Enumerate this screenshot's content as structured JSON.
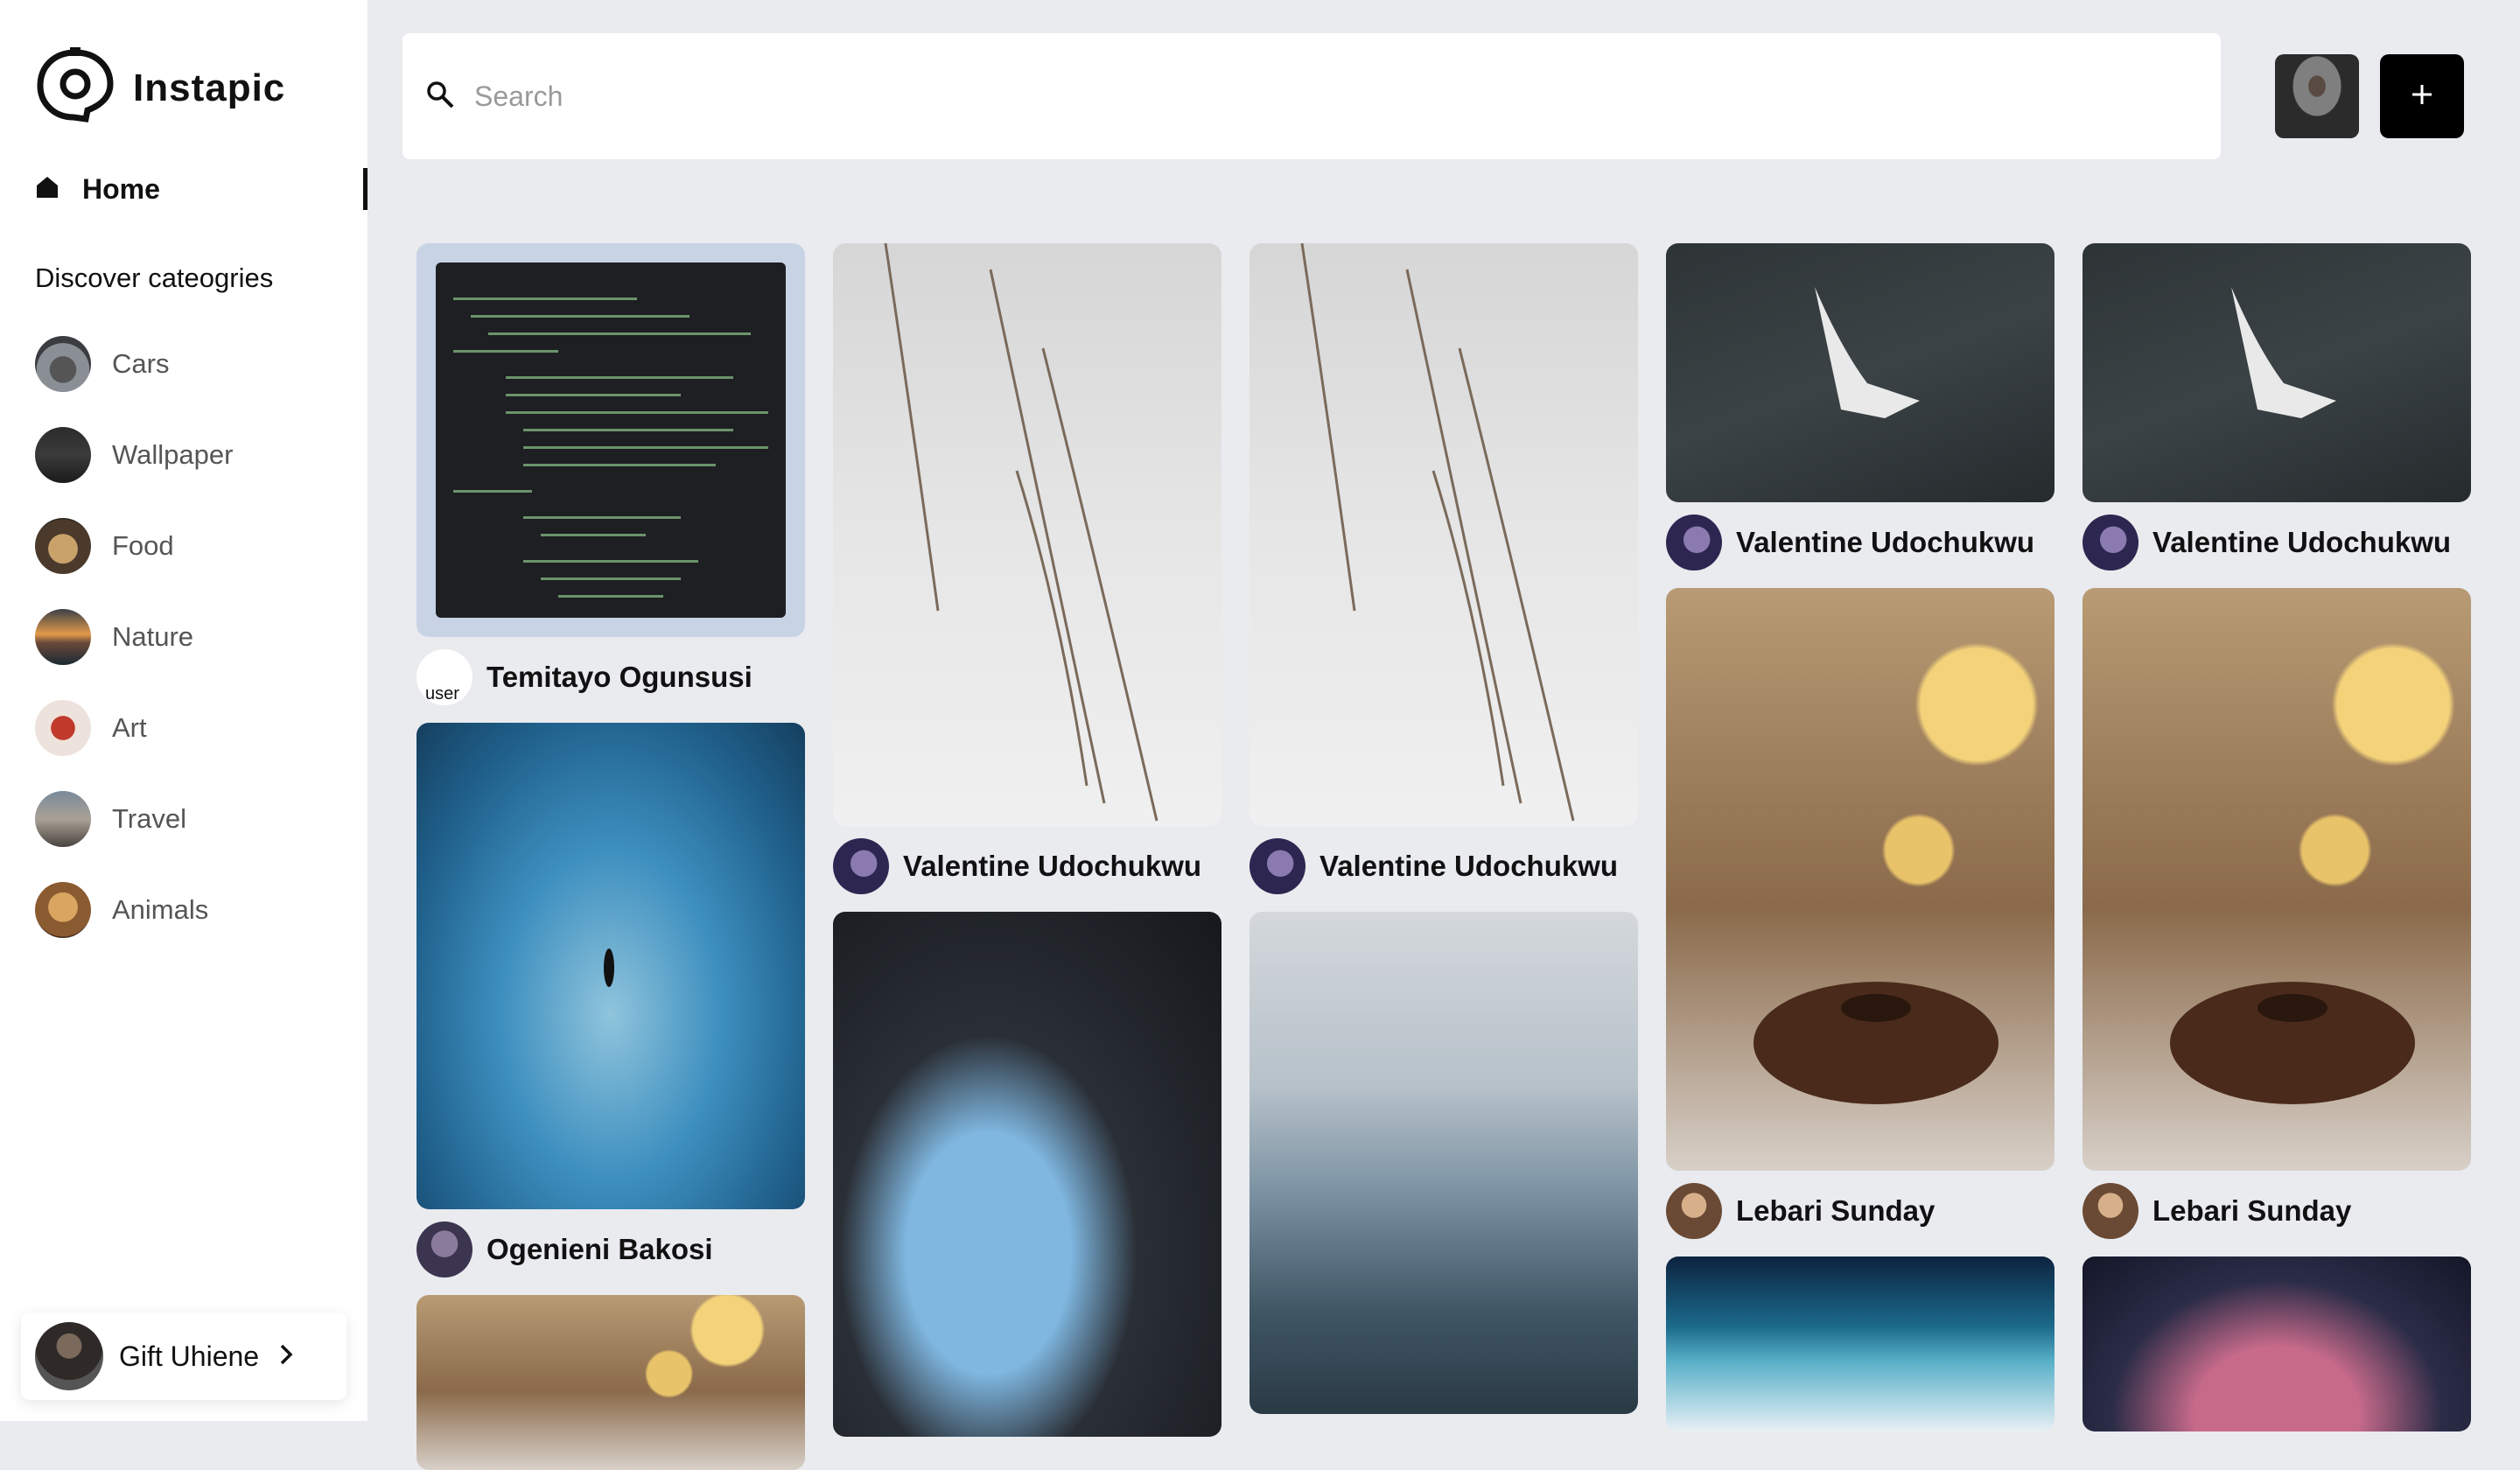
{
  "app": {
    "name": "Instapic"
  },
  "nav": {
    "home_label": "Home"
  },
  "categories": {
    "heading": "Discover cateogries",
    "items": [
      {
        "label": "Cars",
        "icon": "cars-thumbnail"
      },
      {
        "label": "Wallpaper",
        "icon": "wallpaper-thumbnail"
      },
      {
        "label": "Food",
        "icon": "food-thumbnail"
      },
      {
        "label": "Nature",
        "icon": "nature-thumbnail"
      },
      {
        "label": "Art",
        "icon": "art-thumbnail"
      },
      {
        "label": "Travel",
        "icon": "travel-thumbnail"
      },
      {
        "label": "Animals",
        "icon": "animals-thumbnail"
      }
    ]
  },
  "user": {
    "name": "Gift Uhiene"
  },
  "search": {
    "placeholder": "Search"
  },
  "header": {
    "add_label": "+"
  },
  "pins": {
    "col1": [
      {
        "author": "Temitayo Ogunsusi",
        "image": "code-screenshot",
        "avatar_alt": "user"
      },
      {
        "author": "Ogenieni Bakosi",
        "image": "ocean-swimmer"
      },
      {
        "image": "cake-sugar"
      }
    ],
    "col2": [
      {
        "author": "Valentine Udochukwu",
        "image": "snow-grass"
      },
      {
        "image": "sea-cave"
      }
    ],
    "col3": [
      {
        "author": "Valentine Udochukwu",
        "image": "snow-grass"
      },
      {
        "image": "misty-mountains"
      }
    ],
    "col4": [
      {
        "author": "Valentine Udochukwu",
        "image": "seagull"
      },
      {
        "author": "Lebari Sunday",
        "image": "cake-sugar"
      },
      {
        "image": "aurora"
      }
    ],
    "col5": [
      {
        "author": "Valentine Udochukwu",
        "image": "seagull"
      },
      {
        "author": "Lebari Sunday",
        "image": "cake-sugar"
      },
      {
        "image": "brain-art"
      }
    ]
  },
  "colors": {
    "background": "#e9ebef",
    "sidebar": "#ffffff",
    "accent": "#000000",
    "text": "#111111",
    "muted": "#555555"
  }
}
